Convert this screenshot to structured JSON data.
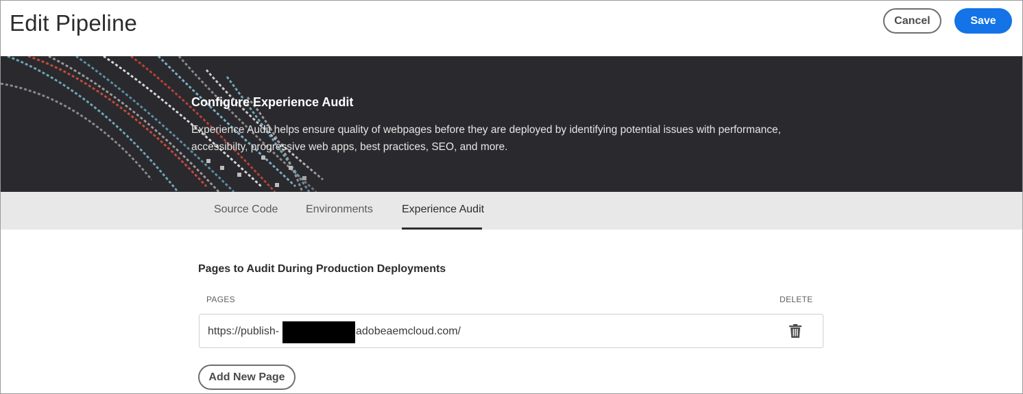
{
  "header": {
    "title": "Edit Pipeline",
    "cancel_label": "Cancel",
    "save_label": "Save",
    "save_color": "#1473e6"
  },
  "banner": {
    "title": "Configure Experience Audit",
    "description": "Experience Audit helps ensure quality of webpages before they are deployed by identifying potential issues with performance, accessibilty, progressive web apps, best practices, SEO, and more.",
    "background_color": "#2a2a2e"
  },
  "tabs": [
    {
      "label": "Source Code",
      "active": false
    },
    {
      "label": "Environments",
      "active": false
    },
    {
      "label": "Experience Audit",
      "active": true
    }
  ],
  "pages_section": {
    "title": "Pages to Audit During Production Deployments",
    "columns": {
      "pages": "PAGES",
      "delete": "DELETE"
    },
    "rows": [
      {
        "url_prefix": "https://publish-",
        "url_suffix": "adobeaemcloud.com/",
        "delete_icon": "trash-icon"
      }
    ],
    "add_label": "Add New Page"
  }
}
